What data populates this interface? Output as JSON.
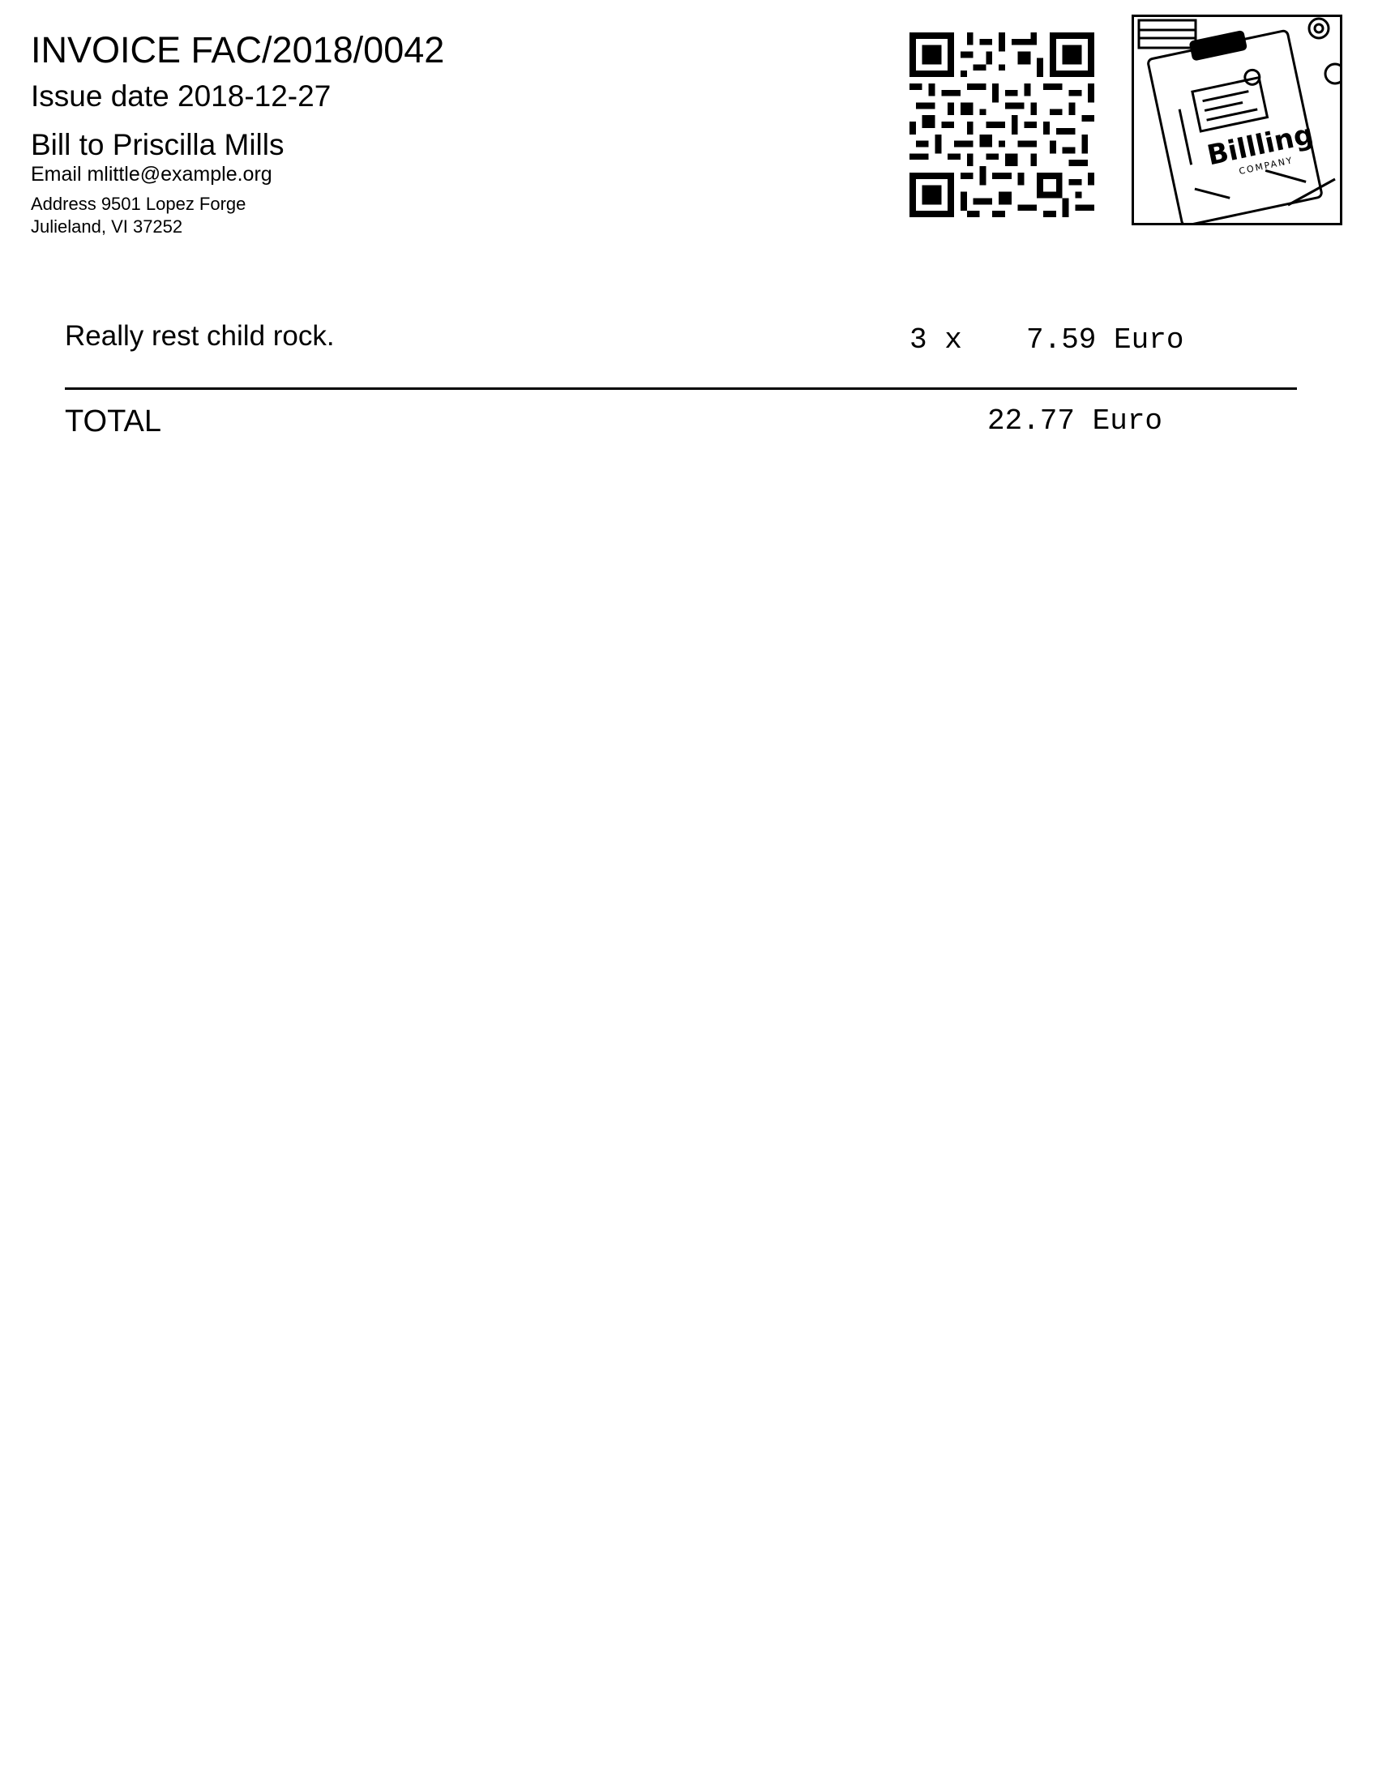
{
  "invoice": {
    "title": "INVOICE FAC/2018/0042",
    "issue_date": "Issue date 2018-12-27",
    "bill_to": "Bill to Priscilla Mills",
    "email": "Email mlittle@example.org",
    "address_line1": "Address 9501 Lopez Forge",
    "address_line2": "Julieland, VI 37252"
  },
  "logo": {
    "text": "Billling",
    "subtext": "COMPANY"
  },
  "items": [
    {
      "description": "Really rest child rock.",
      "quantity": "3 x",
      "price": "7.59 Euro"
    }
  ],
  "total": {
    "label": "TOTAL",
    "value": "22.77 Euro"
  }
}
